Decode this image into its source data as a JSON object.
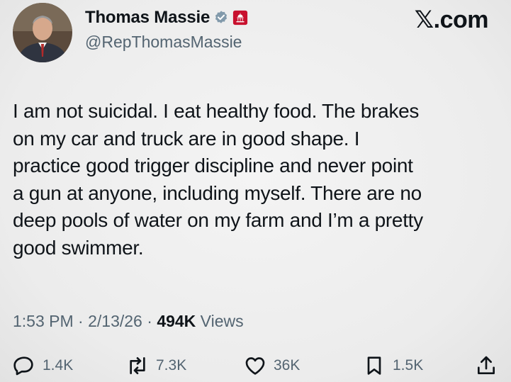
{
  "author": {
    "display_name": "Thomas Massie",
    "handle": "@RepThomasMassie",
    "verified_icon": "verified-badge-icon",
    "affiliation_icon": "us-government-capitol-icon"
  },
  "brand": "𝕏.com",
  "post": {
    "lines": [
      "I am not suicidal. I eat healthy food. The brakes",
      "on my car and truck are in good shape. I",
      "practice good trigger discipline and never point",
      "a gun at anyone,  including myself. There are no",
      "deep pools of water on my farm and I’m a pretty",
      "good swimmer."
    ],
    "time": "1:53 PM",
    "sep1": " · ",
    "date": "2/13/26",
    "sep2": " · ",
    "views_count": "494K",
    "views_label": " Views"
  },
  "actions": {
    "replies": "1.4K",
    "reposts": "7.3K",
    "likes": "36K",
    "bookmarks": "1.5K"
  },
  "colors": {
    "text": "#0f1419",
    "muted": "#536471",
    "verified": "#829aab",
    "gov_badge": "#c8102e"
  }
}
